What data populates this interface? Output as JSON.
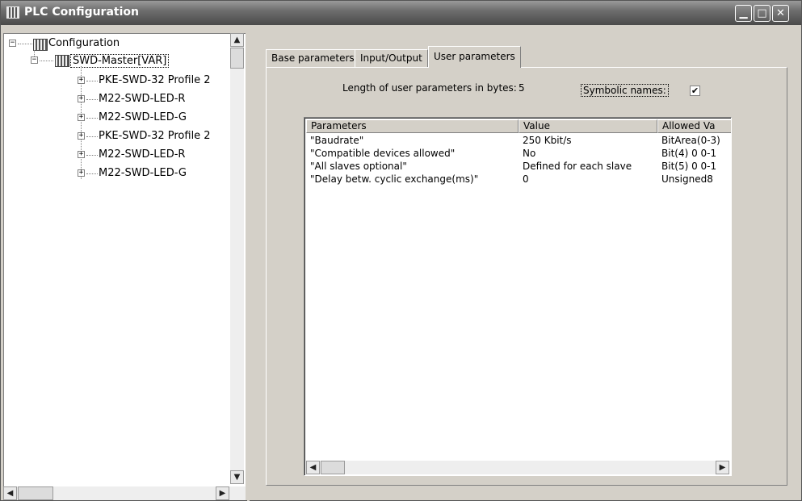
{
  "window": {
    "title": "PLC Configuration",
    "min_glyph": "▁",
    "max_glyph": "□",
    "close_glyph": "✕"
  },
  "tree": {
    "root": {
      "label": "Configuration",
      "expander": "−"
    },
    "master": {
      "label": "SWD-Master[VAR]",
      "expander": "−"
    },
    "children": [
      {
        "label": "PKE-SWD-32 Profile 2",
        "expander": "+"
      },
      {
        "label": "M22-SWD-LED-R",
        "expander": "+"
      },
      {
        "label": "M22-SWD-LED-G",
        "expander": "+"
      },
      {
        "label": "PKE-SWD-32 Profile 2",
        "expander": "+"
      },
      {
        "label": "M22-SWD-LED-R",
        "expander": "+"
      },
      {
        "label": "M22-SWD-LED-G",
        "expander": "+"
      }
    ]
  },
  "scroll_glyphs": {
    "up": "▲",
    "down": "▼",
    "left": "◀",
    "right": "▶"
  },
  "tabs": [
    {
      "label": "Base parameters",
      "active": false
    },
    {
      "label": "Input/Output",
      "active": false
    },
    {
      "label": "User parameters",
      "active": true
    }
  ],
  "user_params": {
    "length_label": "Length of user parameters in bytes:",
    "length_value": "5",
    "symbolic_label": "Symbolic names:",
    "symbolic_checked": "✔"
  },
  "grid": {
    "columns": [
      "Parameters",
      "Value",
      "Allowed Va"
    ],
    "rows": [
      [
        "\"Baudrate\"",
        "250 Kbit/s",
        "BitArea(0-3)"
      ],
      [
        "\"Compatible devices allowed\"",
        "No",
        "Bit(4) 0 0-1"
      ],
      [
        "\"All slaves optional\"",
        "Defined for each slave",
        "Bit(5) 0 0-1"
      ],
      [
        "\"Delay betw. cyclic exchange(ms)\"",
        "0",
        "Unsigned8"
      ]
    ]
  }
}
